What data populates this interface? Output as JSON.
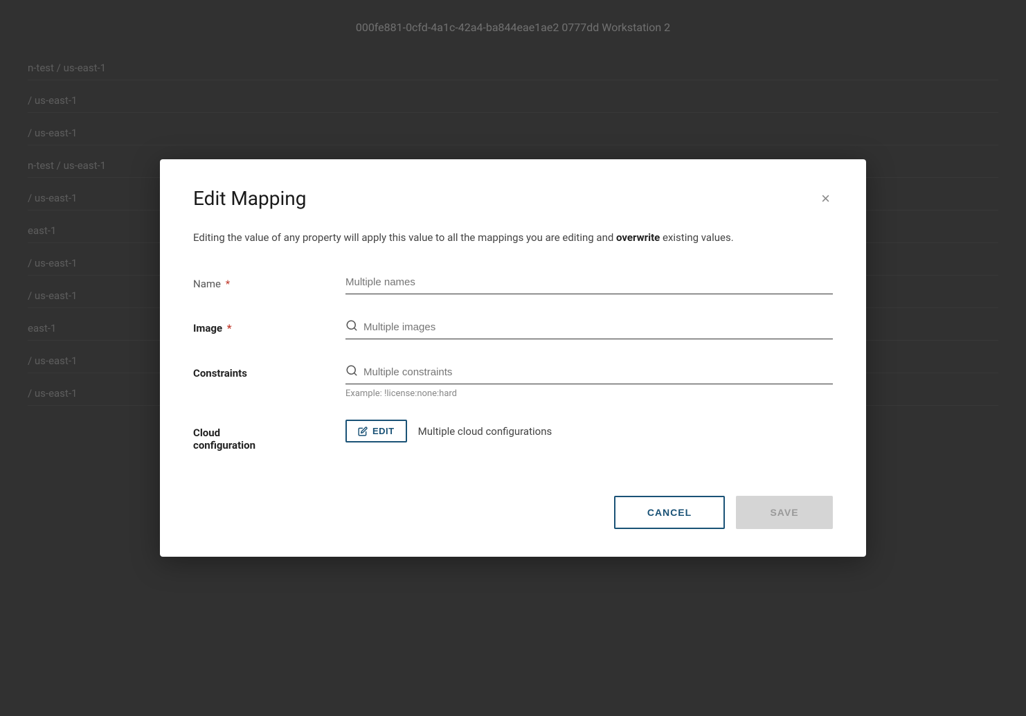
{
  "background": {
    "top_text": "000fe881-0cfd-4a1c-42a4-ba844eae1ae2 0777dd Workstation 2",
    "rows": [
      "n-test / us-east-1",
      "/ us-east-1",
      "/ us-east-1",
      "n-test / us-east-1",
      "/ us-east-1",
      "east-1",
      "/ us-east-1",
      "/ us-east-1",
      "east-1",
      "/ us-east-1",
      "/ us-east-1"
    ]
  },
  "modal": {
    "title": "Edit Mapping",
    "close_icon": "×",
    "description_part1": "Editing the value of any property will apply this value to all the mappings you are editing and ",
    "description_bold": "overwrite",
    "description_part2": " existing values.",
    "fields": {
      "name": {
        "label": "Name",
        "required": true,
        "placeholder": "Multiple names",
        "value": "Multiple names"
      },
      "image": {
        "label": "Image",
        "required": true,
        "placeholder": "Multiple images",
        "value": "Multiple images"
      },
      "constraints": {
        "label": "Constraints",
        "required": false,
        "placeholder": "Multiple constraints",
        "value": "Multiple constraints",
        "hint": "Example: !license:none:hard"
      },
      "cloud_configuration": {
        "label": "Cloud",
        "label2": "configuration",
        "required": false,
        "edit_button_label": "EDIT",
        "edit_icon": "✏",
        "value": "Multiple cloud configurations"
      }
    },
    "footer": {
      "cancel_label": "CANCEL",
      "save_label": "SAVE"
    }
  },
  "icons": {
    "close": "×",
    "search": "search",
    "edit": "edit"
  },
  "colors": {
    "primary_blue": "#1a5276",
    "required_red": "#c0392b",
    "disabled_bg": "#d5d5d5",
    "disabled_text": "#999"
  }
}
